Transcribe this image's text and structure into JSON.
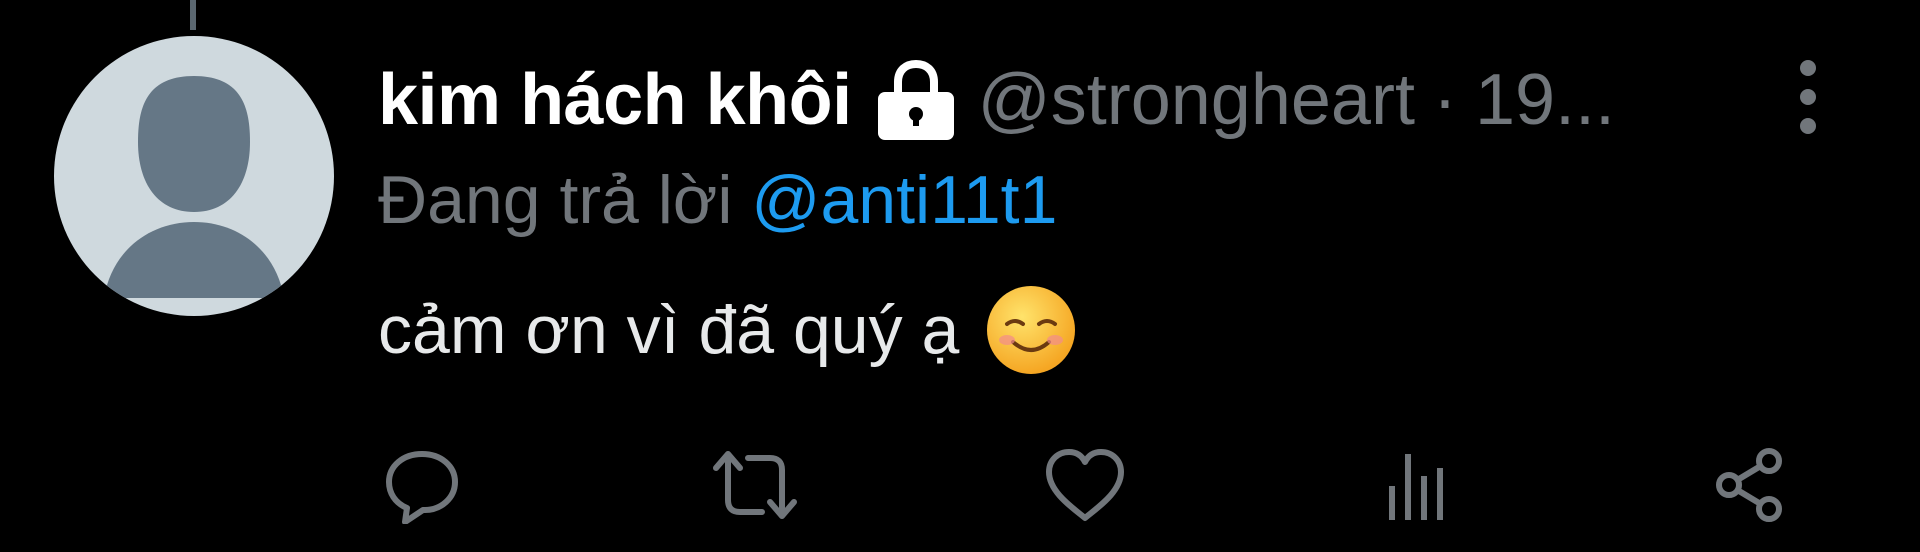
{
  "tweet": {
    "display_name": "kim hách khôi",
    "handle": "@strongheart",
    "separator": "·",
    "time": "19...",
    "reply_prefix": "Đang trả lời",
    "reply_target": "@anti11t1",
    "text": "cảm ơn vì đã quý ạ",
    "emoji": "smiling-face-icon"
  },
  "icons": {
    "avatar": "default-avatar-icon",
    "protected": "lock-icon",
    "more": "more-vertical-icon",
    "reply": "reply-icon",
    "retweet": "retweet-icon",
    "like": "heart-icon",
    "views": "views-icon",
    "share": "share-icon"
  },
  "colors": {
    "background": "#000000",
    "primary_text": "#ffffff",
    "secondary_text": "#71767b",
    "link": "#1d9bf0",
    "avatar_bg": "#cfd9de",
    "avatar_fg": "#657786"
  }
}
